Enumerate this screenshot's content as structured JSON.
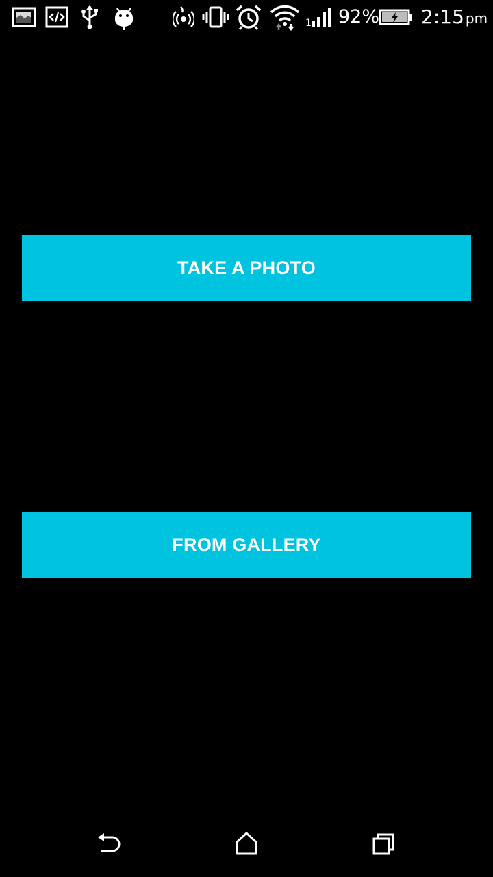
{
  "theme": {
    "background": "#000000",
    "accent": "#00c3e0",
    "text": "#ffffff"
  },
  "status_bar": {
    "left_icons": [
      "screenshot-icon",
      "code-icon",
      "usb-icon",
      "android-debug-icon"
    ],
    "right_icons": [
      "nfc-icon",
      "vibrate-icon",
      "alarm-icon",
      "wifi-icon",
      "signal-icon",
      "battery-charging-icon"
    ],
    "battery_percent": "92%",
    "time": "2:15",
    "time_suffix": "pm"
  },
  "main": {
    "take_photo_label": "TAKE A PHOTO",
    "from_gallery_label": "FROM GALLERY"
  },
  "nav_bar": {
    "icons": [
      "back-icon",
      "home-icon",
      "recents-icon"
    ]
  }
}
